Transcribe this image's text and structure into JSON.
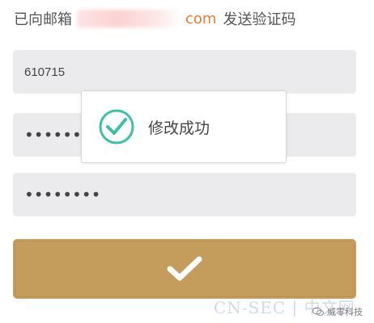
{
  "notice": {
    "prefix": "已向邮箱",
    "email_tail": "com",
    "suffix": "发送验证码"
  },
  "form": {
    "code_value": "610715",
    "password_mask": "••••••••",
    "confirm_mask": "••••••••"
  },
  "submit": {
    "icon": "checkmark-icon",
    "color": "#c49c5c"
  },
  "toast": {
    "message": "修改成功",
    "icon": "success-check-icon",
    "icon_color": "#3cc0a6"
  },
  "watermark": {
    "brand": "威零科技",
    "site": "CN-SEC | 中文网"
  }
}
